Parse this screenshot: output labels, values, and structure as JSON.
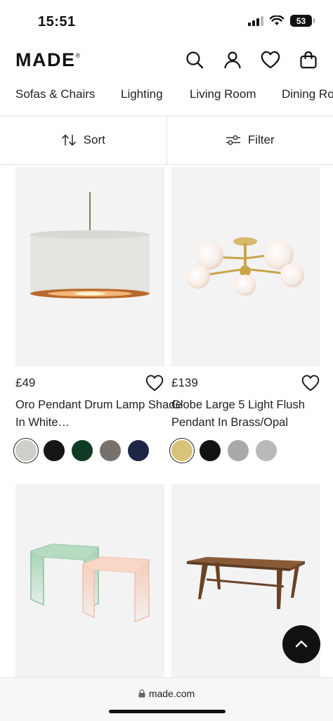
{
  "status": {
    "time": "15:51",
    "battery": "53",
    "icons": [
      "cellular-signal-icon",
      "wifi-icon",
      "battery-icon"
    ]
  },
  "header": {
    "logo": "MADE",
    "logo_mark": "®",
    "icons": [
      "search-icon",
      "account-icon",
      "wishlist-heart-icon",
      "shopping-bag-icon"
    ]
  },
  "nav": {
    "categories": [
      "Sofas & Chairs",
      "Lighting",
      "Living Room",
      "Dining Room"
    ]
  },
  "toolbar": {
    "sort_label": "Sort",
    "filter_label": "Filter"
  },
  "products": [
    {
      "price": "£49",
      "title": "Oro Pendant Drum Lamp Shade In White…",
      "swatches": [
        "#cfcfcb",
        "#161616",
        "#0f3b24",
        "#77716d",
        "#1f2645"
      ]
    },
    {
      "price": "£139",
      "title": "Globe Large 5 Light Flush Pendant In Brass/Opal",
      "swatches": [
        "#d9c27a",
        "#121212",
        "#a9a9a9",
        "#b9b9b9"
      ]
    },
    {
      "price": "",
      "title": "",
      "swatches": []
    },
    {
      "price": "",
      "title": "",
      "swatches": []
    }
  ],
  "browser": {
    "url": "made.com"
  },
  "colors": {
    "text": "#222222",
    "fab": "#111111",
    "image_bg": "#f3f3f3"
  }
}
